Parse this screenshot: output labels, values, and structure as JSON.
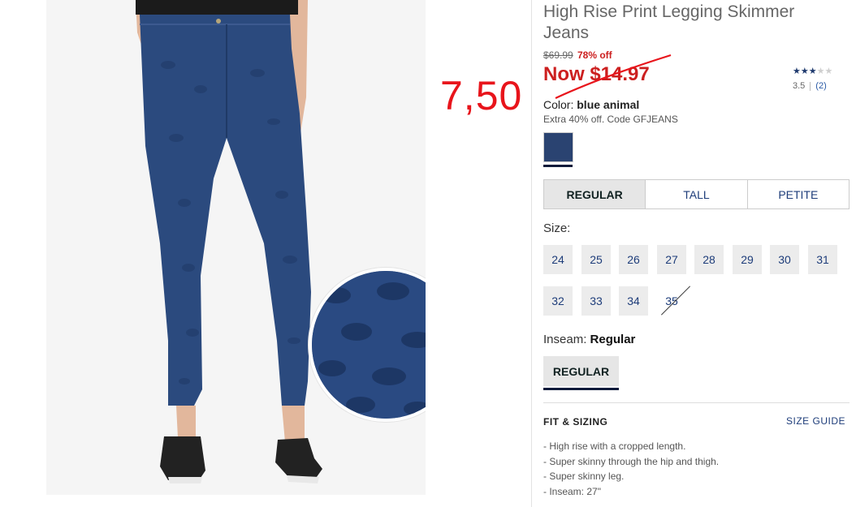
{
  "product": {
    "title": "High Rise Print Legging Skimmer Jeans",
    "original_price": "$69.99",
    "percent_off": "78% off",
    "now_price": "Now $14.97",
    "rating": {
      "value": "3.5",
      "count": "(2)",
      "stars": 3.5
    },
    "color_label": "Color:",
    "color_value": "blue animal",
    "promo": "Extra 40% off. Code GFJEANS",
    "swatch_color": "#2a4371"
  },
  "annotation": {
    "handwritten_price": "7,50",
    "color": "#e8141b"
  },
  "fit_tabs": [
    {
      "label": "REGULAR",
      "active": true
    },
    {
      "label": "TALL",
      "active": false
    },
    {
      "label": "PETITE",
      "active": false
    }
  ],
  "size": {
    "label": "Size:",
    "options": [
      {
        "label": "24",
        "available": true
      },
      {
        "label": "25",
        "available": true
      },
      {
        "label": "26",
        "available": true
      },
      {
        "label": "27",
        "available": true
      },
      {
        "label": "28",
        "available": true
      },
      {
        "label": "29",
        "available": true
      },
      {
        "label": "30",
        "available": true
      },
      {
        "label": "31",
        "available": true
      },
      {
        "label": "32",
        "available": true
      },
      {
        "label": "33",
        "available": true
      },
      {
        "label": "34",
        "available": true
      },
      {
        "label": "35",
        "available": false
      }
    ]
  },
  "inseam": {
    "label": "Inseam:",
    "value": "Regular",
    "button": "REGULAR"
  },
  "fit_sizing": {
    "heading": "FIT & SIZING",
    "guide_link": "SIZE GUIDE",
    "bullets": [
      "- High rise with a cropped length.",
      "- Super skinny through the hip and thigh.",
      "- Super skinny leg.",
      "- Inseam: 27\""
    ]
  }
}
